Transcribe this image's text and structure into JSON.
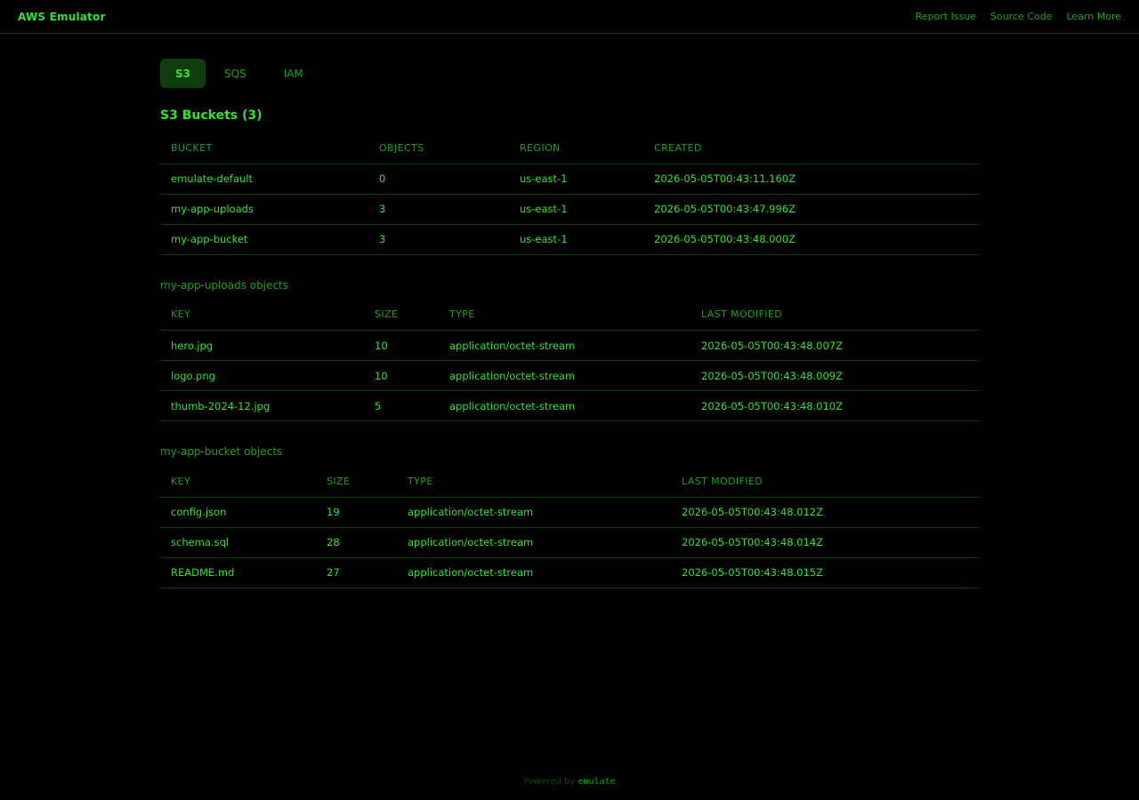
{
  "header": {
    "brand": "AWS Emulator",
    "links": [
      "Report Issue",
      "Source Code",
      "Learn More"
    ]
  },
  "tabs": [
    {
      "label": "S3",
      "active": true
    },
    {
      "label": "SQS",
      "active": false
    },
    {
      "label": "IAM",
      "active": false
    }
  ],
  "buckets": {
    "title": "S3 Buckets (3)",
    "columns": [
      "BUCKET",
      "OBJECTS",
      "REGION",
      "CREATED"
    ],
    "rows": [
      [
        "emulate-default",
        "0",
        "us-east-1",
        "2026-05-05T00:43:11.160Z"
      ],
      [
        "my-app-uploads",
        "3",
        "us-east-1",
        "2026-05-05T00:43:47.996Z"
      ],
      [
        "my-app-bucket",
        "3",
        "us-east-1",
        "2026-05-05T00:43:48.000Z"
      ]
    ]
  },
  "uploads_objects": {
    "title": "my-app-uploads objects",
    "columns": [
      "KEY",
      "SIZE",
      "TYPE",
      "LAST MODIFIED"
    ],
    "rows": [
      [
        "hero.jpg",
        "10",
        "application/octet-stream",
        "2026-05-05T00:43:48.007Z"
      ],
      [
        "logo.png",
        "10",
        "application/octet-stream",
        "2026-05-05T00:43:48.009Z"
      ],
      [
        "thumb-2024-12.jpg",
        "5",
        "application/octet-stream",
        "2026-05-05T00:43:48.010Z"
      ]
    ]
  },
  "bucket_objects": {
    "title": "my-app-bucket objects",
    "columns": [
      "KEY",
      "SIZE",
      "TYPE",
      "LAST MODIFIED"
    ],
    "rows": [
      [
        "config.json",
        "19",
        "application/octet-stream",
        "2026-05-05T00:43:48.012Z"
      ],
      [
        "schema.sql",
        "28",
        "application/octet-stream",
        "2026-05-05T00:43:48.014Z"
      ],
      [
        "README.md",
        "27",
        "application/octet-stream",
        "2026-05-05T00:43:48.015Z"
      ]
    ]
  },
  "footer": {
    "prefix": "Powered by",
    "link": "emulate"
  },
  "colors": {
    "background": "#000000",
    "accent": "#33e033",
    "muted": "#1f9f1f",
    "border": "#0f3d0f"
  }
}
